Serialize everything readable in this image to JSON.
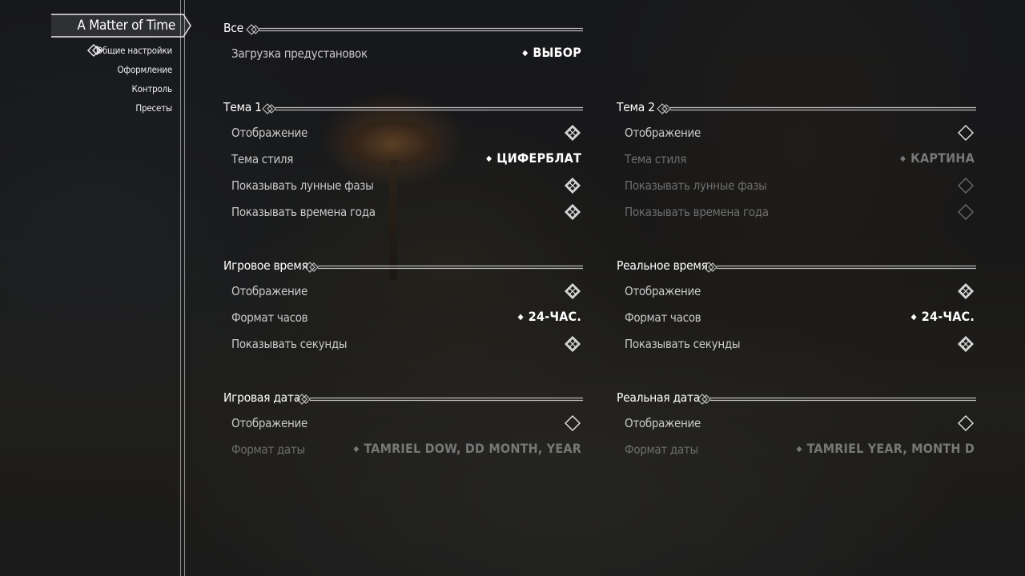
{
  "nav": {
    "title": "A Matter of Time",
    "items": [
      "Общие настройки",
      "Оформление",
      "Контроль",
      "Пресеты"
    ]
  },
  "sections": {
    "all": {
      "title": "Все",
      "preset_label": "Загрузка предустановок",
      "preset_value": "ВЫБОР"
    },
    "theme1": {
      "title": "Тема 1",
      "display_label": "Отображение",
      "display_checked": true,
      "style_label": "Тема стиля",
      "style_value": "ЦИФЕРБЛАТ",
      "moon_label": "Показывать лунные фазы",
      "moon_checked": true,
      "seasons_label": "Показывать времена года",
      "seasons_checked": true
    },
    "theme2": {
      "title": "Тема 2",
      "display_label": "Отображение",
      "display_checked": false,
      "style_label": "Тема стиля",
      "style_value": "КАРТИНА",
      "moon_label": "Показывать лунные фазы",
      "moon_checked": false,
      "seasons_label": "Показывать времена года",
      "seasons_checked": false
    },
    "game_time": {
      "title": "Игровое время",
      "display_label": "Отображение",
      "display_checked": true,
      "format_label": "Формат часов",
      "format_value": "24-ЧАС.",
      "seconds_label": "Показывать секунды",
      "seconds_checked": true
    },
    "real_time": {
      "title": "Реальное время",
      "display_label": "Отображение",
      "display_checked": true,
      "format_label": "Формат часов",
      "format_value": "24-ЧАС.",
      "seconds_label": "Показывать секунды",
      "seconds_checked": true
    },
    "game_date": {
      "title": "Игровая дата",
      "display_label": "Отображение",
      "display_checked": false,
      "format_label": "Формат даты",
      "format_value": "TAMRIEL DOW, DD MONTH, YEAR"
    },
    "real_date": {
      "title": "Реальная дата",
      "display_label": "Отображение",
      "display_checked": false,
      "format_label": "Формат даты",
      "format_value": "TAMRIEL YEAR, MONTH D"
    }
  },
  "colors": {
    "text_active": "#c9c9c9",
    "text_disabled": "#6e6e6e",
    "value_active": "#ffffff",
    "rule": "#bdbdbd"
  },
  "icons": {
    "checked": "checked-diamond-icon",
    "unchecked": "empty-diamond-icon",
    "dropdown": "dropdown-dot-icon",
    "section": "section-arrow-icon"
  }
}
